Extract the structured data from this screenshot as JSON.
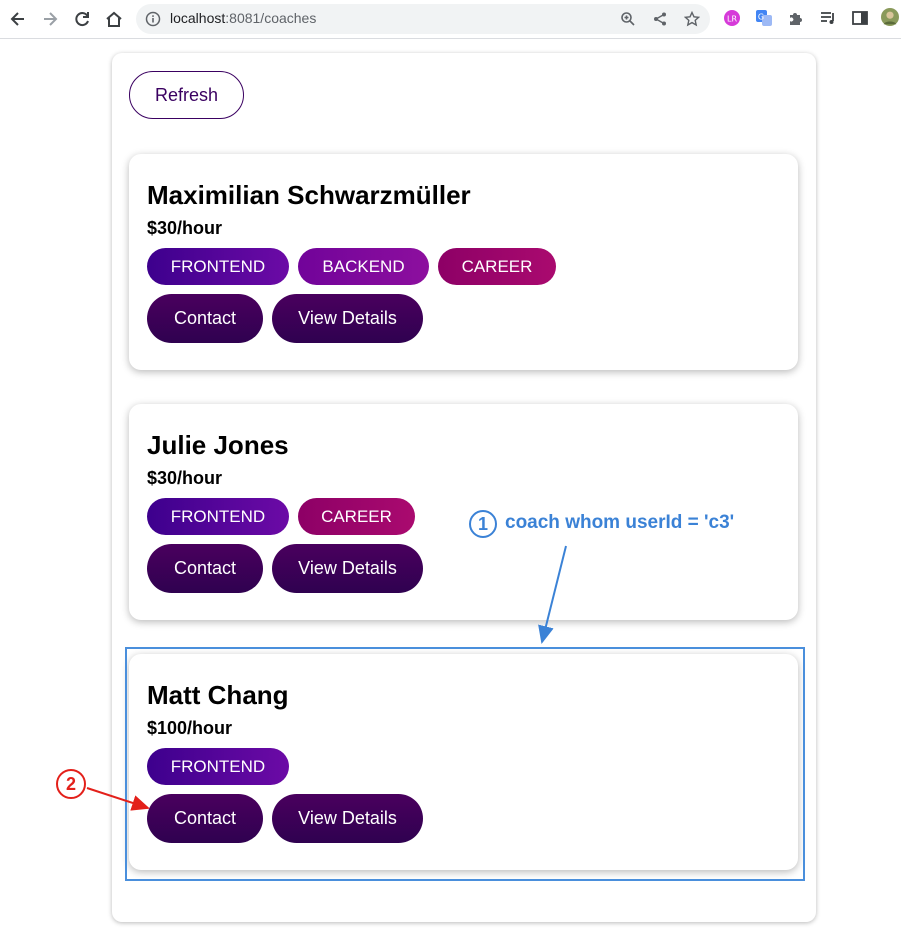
{
  "browser": {
    "url_host": "localhost",
    "url_rest": ":8081/coaches",
    "icons": [
      "back-icon",
      "forward-icon",
      "reload-icon",
      "home-icon",
      "site-info-icon",
      "zoom-icon",
      "share-icon",
      "bookmark-star-icon",
      "extension-lr-icon",
      "translate-icon",
      "extensions-puzzle-icon",
      "media-queue-icon",
      "side-panel-icon",
      "profile-avatar-icon"
    ]
  },
  "toolbar": {
    "refresh_label": "Refresh"
  },
  "coaches": [
    {
      "name": "Maximilian Schwarzmüller",
      "rate": "$30/hour",
      "areas": [
        "FRONTEND",
        "BACKEND",
        "CAREER"
      ],
      "contact_label": "Contact",
      "details_label": "View Details"
    },
    {
      "name": "Julie Jones",
      "rate": "$30/hour",
      "areas": [
        "FRONTEND",
        "CAREER"
      ],
      "contact_label": "Contact",
      "details_label": "View Details"
    },
    {
      "name": "Matt Chang",
      "rate": "$100/hour",
      "areas": [
        "FRONTEND"
      ],
      "contact_label": "Contact",
      "details_label": "View Details"
    }
  ],
  "annotations": {
    "one_number": "1",
    "one_text": "coach whom userId = 'c3'",
    "two_number": "2",
    "colors": {
      "blue": "#3b82d6",
      "red": "#e3201a"
    }
  },
  "colors": {
    "frontend": "#4b0094",
    "backend": "#7f079c",
    "career": "#9c0569",
    "action_button": "#3d0157",
    "outline": "#3a0061"
  }
}
